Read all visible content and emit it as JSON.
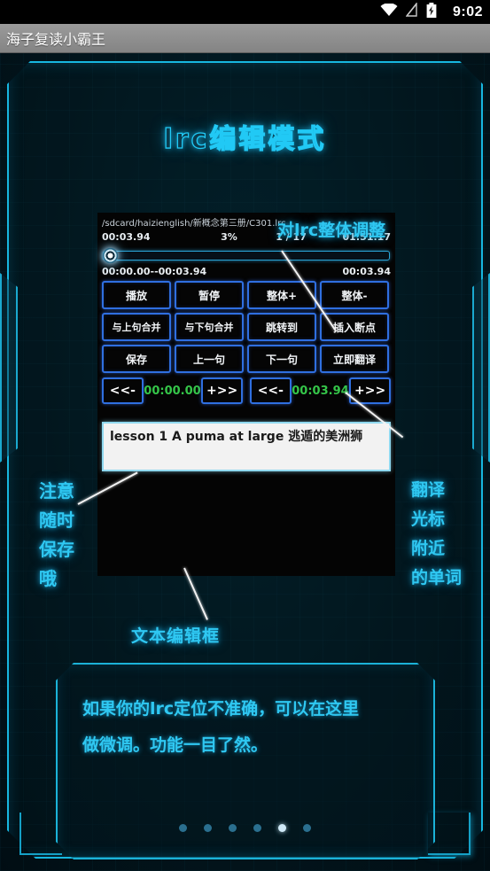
{
  "status_bar": {
    "time": "9:02",
    "icons": [
      "wifi-icon",
      "signal-off-icon",
      "battery-charging-icon"
    ]
  },
  "title_bar": {
    "title": "海子复读小霸王"
  },
  "screen": {
    "heading": "lrc编辑模式"
  },
  "player": {
    "file_path": "/sdcard/haizienglish/新概念第三册/C301.lrc",
    "current_time": "00:03.94",
    "percent": "3%",
    "index": "1 / 17",
    "total_time": "01:51.17",
    "seek_value": 3,
    "range_label": "00:00.00--00:03.94",
    "segment_length": "00:03.94",
    "buttons": [
      {
        "label": "播放",
        "name": "play-button"
      },
      {
        "label": "暂停",
        "name": "pause-button"
      },
      {
        "label": "整体+",
        "name": "shift-all-plus-button"
      },
      {
        "label": "整体-",
        "name": "shift-all-minus-button"
      },
      {
        "label": "与上句合并",
        "name": "merge-previous-button"
      },
      {
        "label": "与下句合并",
        "name": "merge-next-button"
      },
      {
        "label": "跳转到",
        "name": "jump-to-button"
      },
      {
        "label": "插入断点",
        "name": "insert-breakpoint-button"
      },
      {
        "label": "保存",
        "name": "save-button"
      },
      {
        "label": "上一句",
        "name": "previous-line-button"
      },
      {
        "label": "下一句",
        "name": "next-line-button"
      },
      {
        "label": "立即翻译",
        "name": "translate-now-button"
      }
    ],
    "adjust": {
      "dec_label": "<<-",
      "inc_label": "+>>",
      "start_value": "00:00.00",
      "end_value": "00:03.94",
      "value_color": "#35c649"
    },
    "text_editor": {
      "value": "lesson 1  A puma at large 逃遁的美洲狮"
    }
  },
  "annotations": {
    "top": "对lrc整体调整",
    "left": "注意\n随时\n保存\n哦",
    "right": "翻译\n光标\n附近\n的单词",
    "editor": "文本编辑框"
  },
  "description": {
    "line1": "如果你的lrc定位不准确，可以在这里",
    "line2": "做微调。功能一目了然。"
  },
  "pager": {
    "count": 6,
    "active_index": 4
  },
  "colors": {
    "accent_cyan": "#2fc8f2",
    "button_border": "#2f6fe0",
    "value_green": "#35c649",
    "background": "#021820"
  }
}
